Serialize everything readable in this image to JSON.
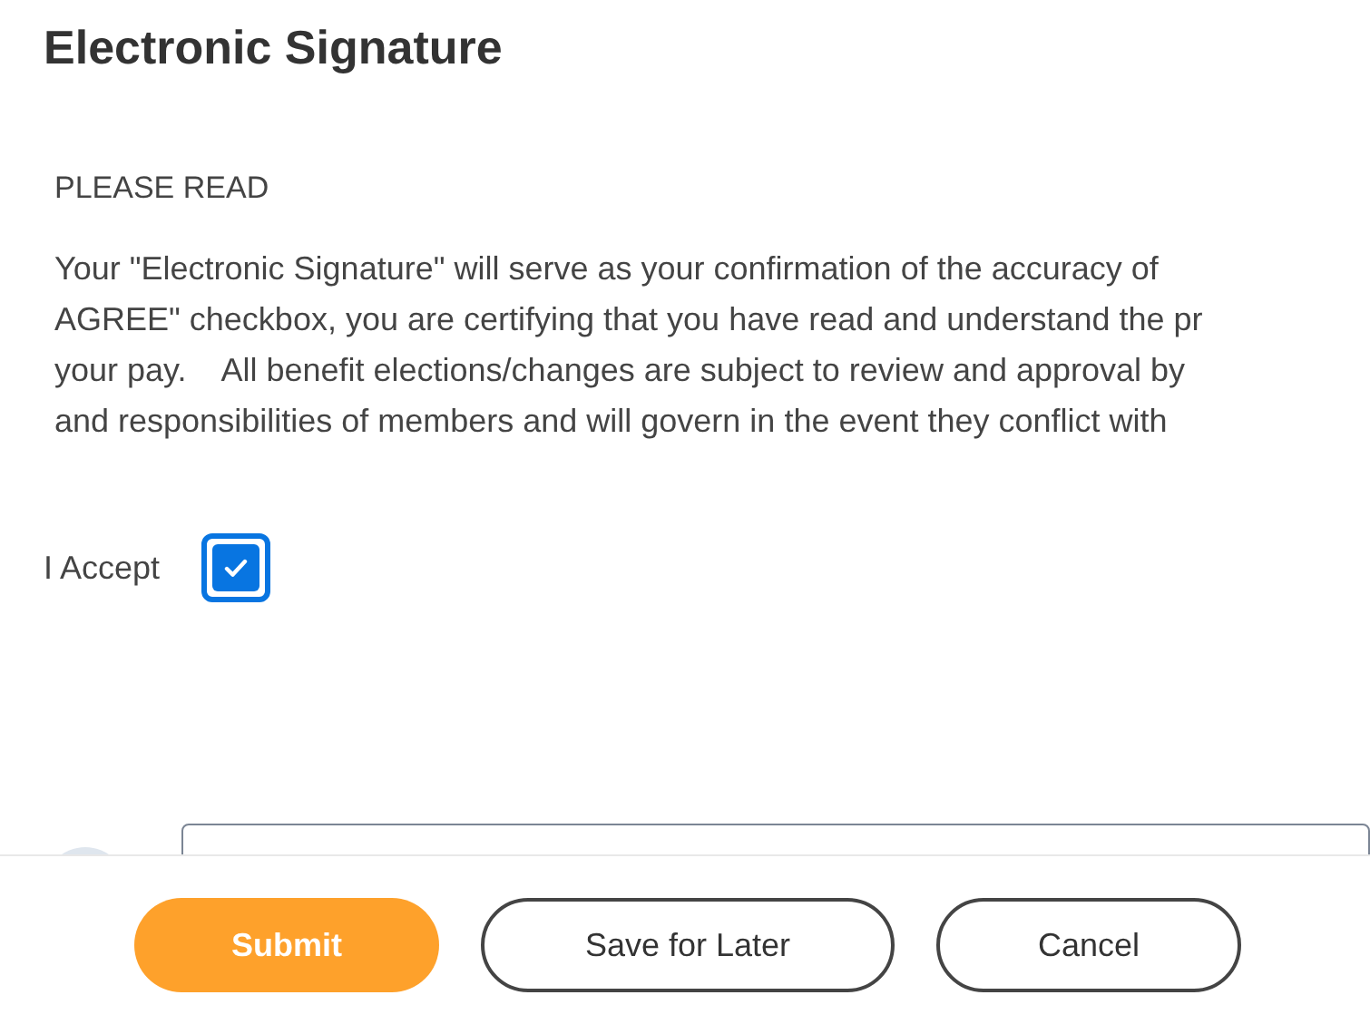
{
  "title": "Electronic Signature",
  "section_heading": "PLEASE READ",
  "paragraph_lines": [
    "Your \"Electronic Signature\" will serve as your confirmation of the accuracy of",
    "AGREE\" checkbox, you are certifying that you have read and understand the pr",
    "your pay.    All benefit elections/changes are subject to review and approval by",
    "and responsibilities of members and will govern in the event they conflict with"
  ],
  "accept": {
    "label": "I Accept",
    "checked": true
  },
  "buttons": [
    {
      "label": "Submit",
      "kind": "primary"
    },
    {
      "label": "Save for Later",
      "kind": "secondary"
    },
    {
      "label": "Cancel",
      "kind": "secondary"
    }
  ]
}
